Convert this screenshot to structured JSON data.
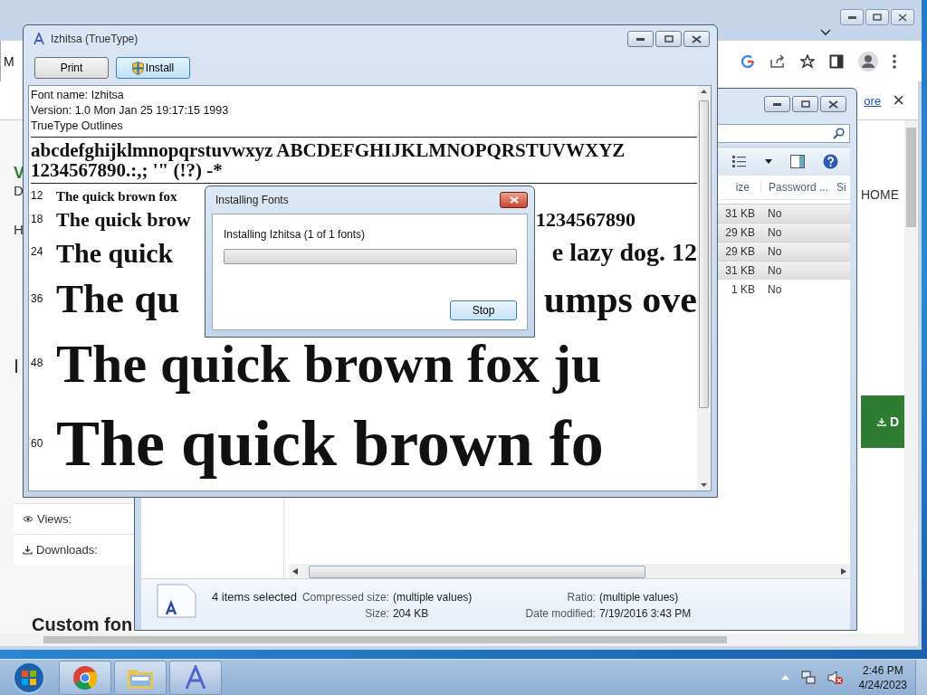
{
  "browser": {
    "toolbar_fragment": "M",
    "infobar_link": "ore",
    "infobar_close": "×",
    "page": {
      "left_letters": [
        "V",
        "D",
        "H",
        "I"
      ],
      "stats": [
        {
          "label": "Views:",
          "kind": "views"
        },
        {
          "label": "Downloads:",
          "kind": "downloads"
        }
      ],
      "heading": "Custom fon",
      "nav_label": "HOME",
      "download_label": "D"
    }
  },
  "explorer": {
    "columns": [
      "ize",
      "Password ...",
      "Si"
    ],
    "rows": [
      {
        "size": "31 KB",
        "password": "No",
        "selected": true
      },
      {
        "size": "29 KB",
        "password": "No",
        "selected": true
      },
      {
        "size": "29 KB",
        "password": "No",
        "selected": true
      },
      {
        "size": "31 KB",
        "password": "No",
        "selected": true
      },
      {
        "size": "1 KB",
        "password": "No",
        "selected": false
      }
    ],
    "details": {
      "count": "4 items selected",
      "fields": [
        {
          "label": "Compressed size:",
          "value": "(multiple values)"
        },
        {
          "label": "Ratio:",
          "value": "(multiple values)"
        },
        {
          "label": "Size:",
          "value": "204 KB"
        },
        {
          "label": "Date modified:",
          "value": "7/19/2016 3:43 PM"
        }
      ]
    }
  },
  "font_window": {
    "title": "Izhitsa (TrueType)",
    "buttons": [
      {
        "label": "Print",
        "kind": "plain"
      },
      {
        "label": "Install",
        "kind": "shield"
      }
    ],
    "info": [
      "Font name: Izhitsa",
      "Version: 1.0 Mon Jan 25 19:17:15 1993",
      "TrueType Outlines"
    ],
    "charset": [
      "abcdefghijklmnopqrstuvwxyz ABCDEFGHIJKLMNOPQRSTUVWXYZ",
      "1234567890.:,;  '\" (!?) -*"
    ],
    "samples": [
      {
        "size": "12",
        "text": "The quick brown fox"
      },
      {
        "size": "18",
        "text": "The quick brow",
        "text_after": "1234567890"
      },
      {
        "size": "24",
        "text": "The quick",
        "text_after": "e lazy dog. 12"
      },
      {
        "size": "36",
        "text": "The qu",
        "text_after": "umps ove"
      },
      {
        "size": "48",
        "text": "The quick brown fox ju"
      },
      {
        "size": "60",
        "text": "The quick brown fo"
      }
    ]
  },
  "dialog": {
    "title": "Installing Fonts",
    "message": "Installing Izhitsa (1 of 1 fonts)",
    "progress": {
      "level": 0
    },
    "button": "Stop"
  },
  "taskbar": {
    "apps": [
      {
        "kind": "chrome"
      },
      {
        "kind": "folder"
      },
      {
        "kind": "font"
      }
    ],
    "clock": {
      "time": "2:46 PM",
      "date": "4/24/2023"
    }
  }
}
